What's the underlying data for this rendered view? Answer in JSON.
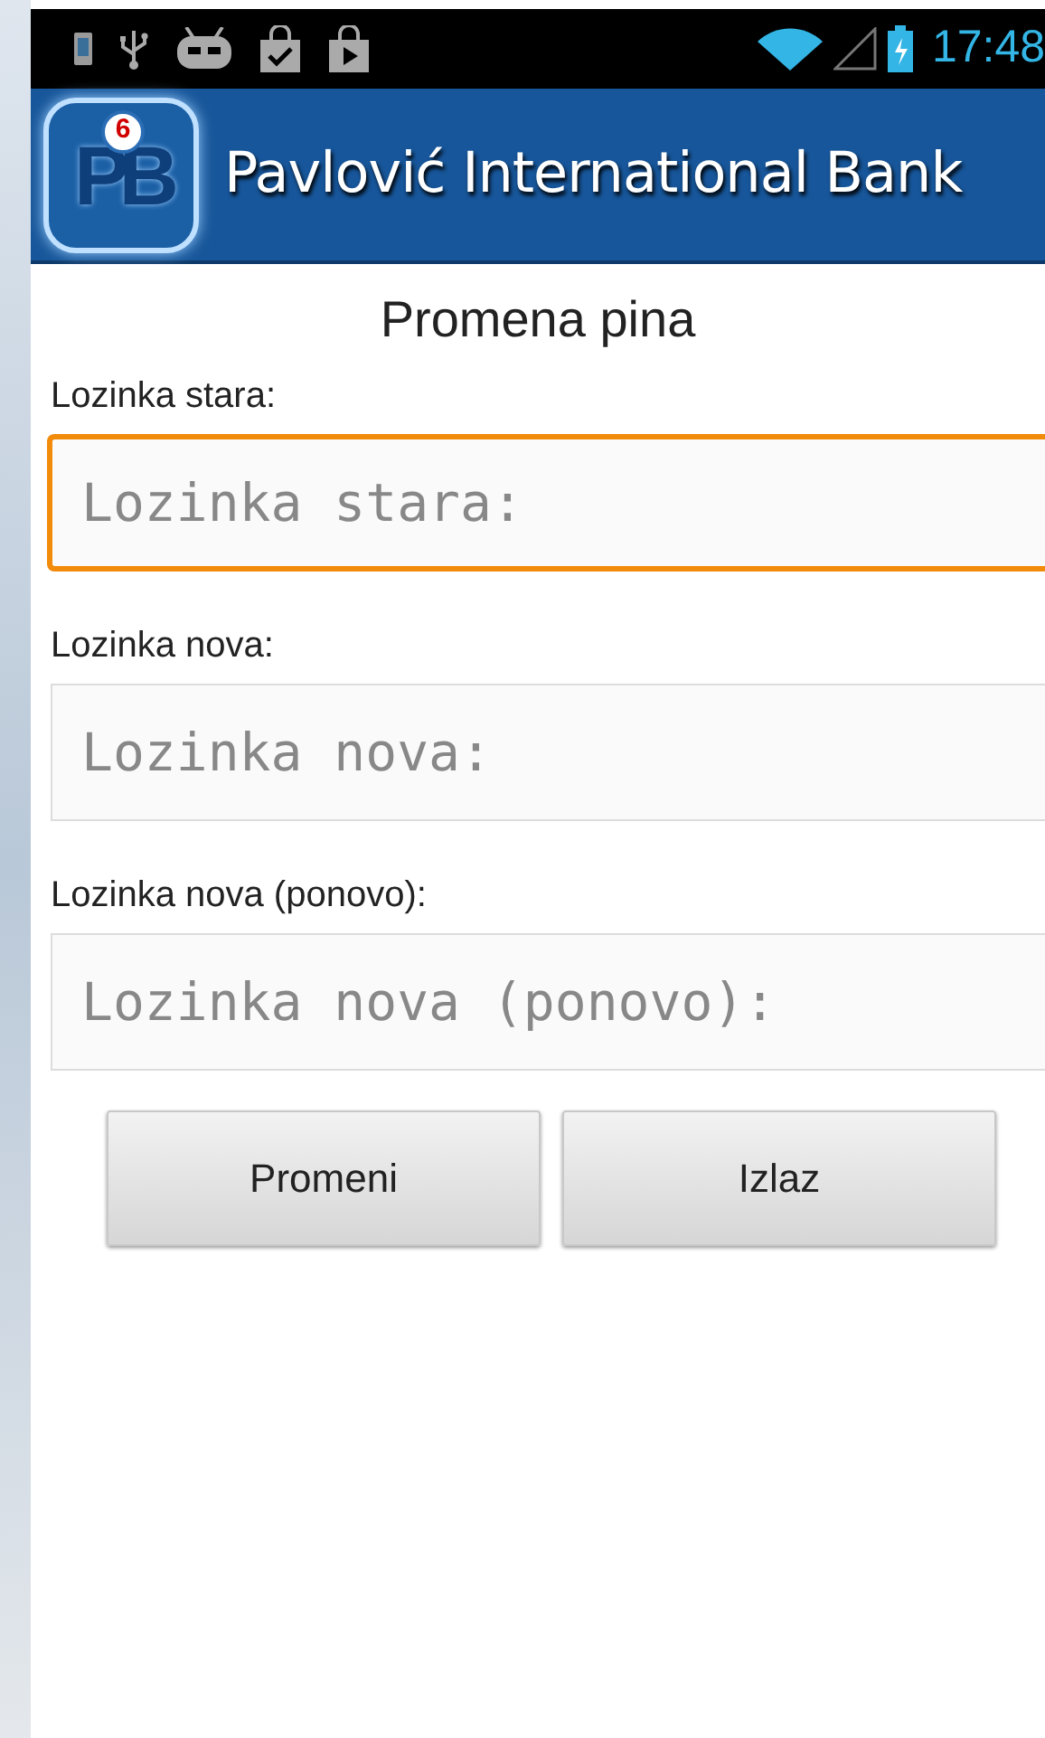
{
  "status_bar": {
    "time": "17:48"
  },
  "header": {
    "logo": {
      "letters": "PB",
      "badge": "6"
    },
    "title": "Pavlović International Bank"
  },
  "screen_title": "Promena pina",
  "fields": [
    {
      "label": "Lozinka stara:",
      "placeholder": "Lozinka stara:",
      "focused": true
    },
    {
      "label": "Lozinka nova:",
      "placeholder": "Lozinka nova:",
      "focused": false
    },
    {
      "label": "Lozinka nova (ponovo):",
      "placeholder": "Lozinka nova (ponovo):",
      "focused": false
    }
  ],
  "buttons": [
    "Promeni",
    "Izlaz"
  ]
}
